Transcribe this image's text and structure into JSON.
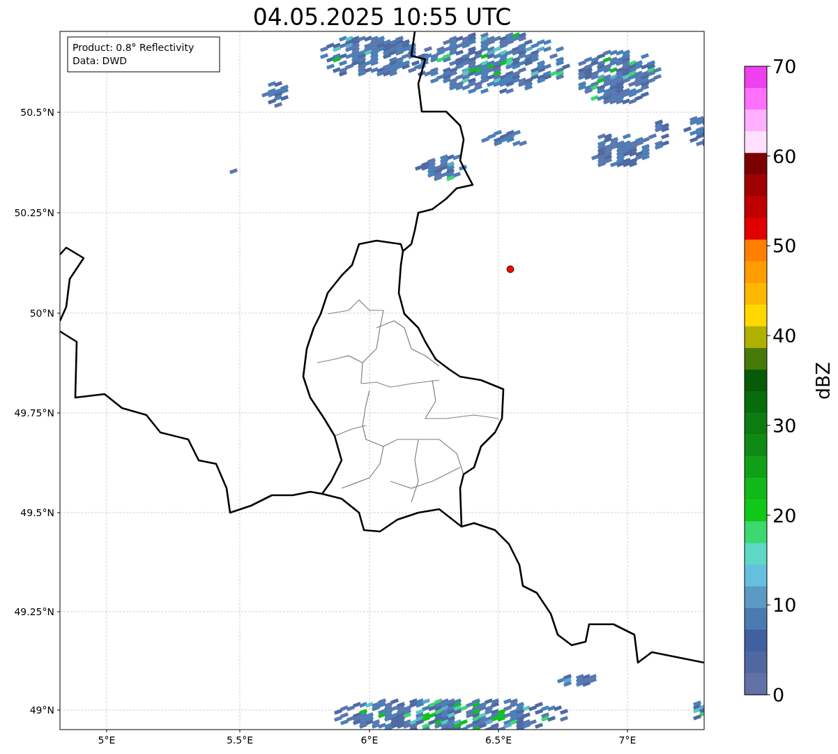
{
  "title": "04.05.2025 10:55 UTC",
  "info_box": [
    "Product: 0.8° Reflectivity",
    "Data: DWD"
  ],
  "lat_ticks": [
    "50.5°N",
    "50.25°N",
    "50°N",
    "49.75°N",
    "49.5°N",
    "49.25°N",
    "49°N"
  ],
  "lon_ticks": [
    "5°E",
    "5.5°E",
    "6°E",
    "6.5°E",
    "7°E"
  ],
  "colorbar": {
    "label": "dBZ",
    "ticks": [
      "70",
      "60",
      "50",
      "40",
      "30",
      "20",
      "10",
      "0"
    ],
    "bins": [
      {
        "color": "#ee40ee"
      },
      {
        "color": "#ff70ff"
      },
      {
        "color": "#ffb0ff"
      },
      {
        "color": "#ffe0ff"
      },
      {
        "color": "#7c0000"
      },
      {
        "color": "#a00000"
      },
      {
        "color": "#c00000"
      },
      {
        "color": "#e00000"
      },
      {
        "color": "#ff8000"
      },
      {
        "color": "#ff9c00"
      },
      {
        "color": "#ffb800"
      },
      {
        "color": "#ffd800"
      },
      {
        "color": "#b0b000"
      },
      {
        "color": "#467a08"
      },
      {
        "color": "#065a08"
      },
      {
        "color": "#086c0c"
      },
      {
        "color": "#0c7c10"
      },
      {
        "color": "#0c8a14"
      },
      {
        "color": "#10a018"
      },
      {
        "color": "#10b818"
      },
      {
        "color": "#10c818"
      },
      {
        "color": "#3cd870"
      },
      {
        "color": "#5cd8c4"
      },
      {
        "color": "#64c0dc"
      },
      {
        "color": "#5a9ac4"
      },
      {
        "color": "#4a7ab0"
      },
      {
        "color": "#4060a0"
      },
      {
        "color": "#5068a0"
      },
      {
        "color": "#6272a7"
      }
    ]
  }
}
